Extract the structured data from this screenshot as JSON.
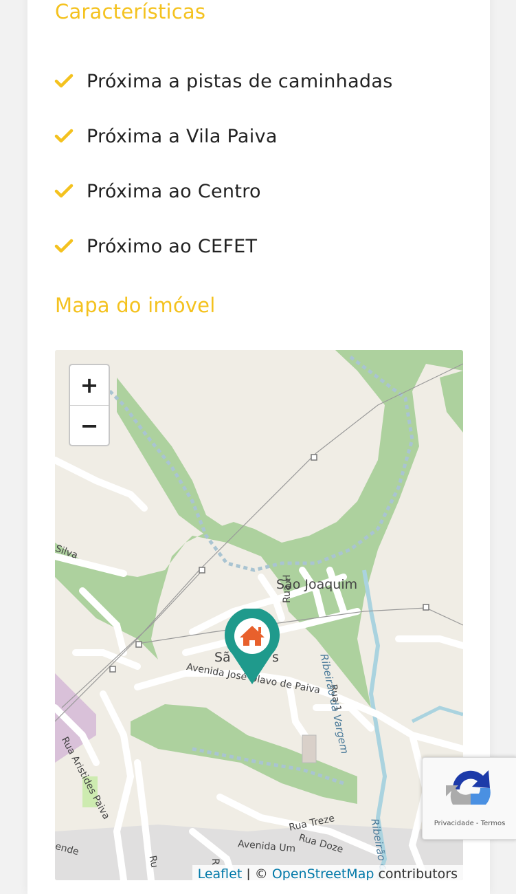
{
  "features_section": {
    "title": "Características",
    "items": [
      {
        "label": "Próxima a pistas de caminhadas"
      },
      {
        "label": "Próxima a Vila Paiva"
      },
      {
        "label": "Próxima ao Centro"
      },
      {
        "label": "Próximo ao CEFET"
      }
    ]
  },
  "map_section": {
    "title": "Mapa do imóvel",
    "zoom_in": "+",
    "zoom_out": "−",
    "labels": {
      "neighborhood": "São Joaquim",
      "neighborhood_partial": "Sã",
      "neighborhood_partial_end": "s",
      "rua_h": "Rua H",
      "rua_1": "Rua 1",
      "avenida": "Avenida José Olavo de Paiva",
      "ribeirao": "Ribeirão da Vargem",
      "ribeirao2": "Ribeirão c",
      "rua_aristides": "Rua Aristides Paiva",
      "silva": "Silva",
      "rua_treze": "Rua Treze",
      "rua_doze": "Rua Doze",
      "avenida_um": "Avenida Um",
      "ende": "ende",
      "ru": "Ru",
      "r": "R"
    },
    "attribution": {
      "leaflet": "Leaflet",
      "separator": " | © ",
      "osm": "OpenStreetMap",
      "suffix": " contributors"
    },
    "marker_icon": "house-icon",
    "colors": {
      "marker": "#1f9a8c",
      "house": "#e8602c",
      "park": "#add19e",
      "water": "#aad3df"
    }
  },
  "recaptcha": {
    "privacy": "Privacidade",
    "separator": " - ",
    "terms": "Termos"
  },
  "colors": {
    "accent": "#f4c21f"
  }
}
